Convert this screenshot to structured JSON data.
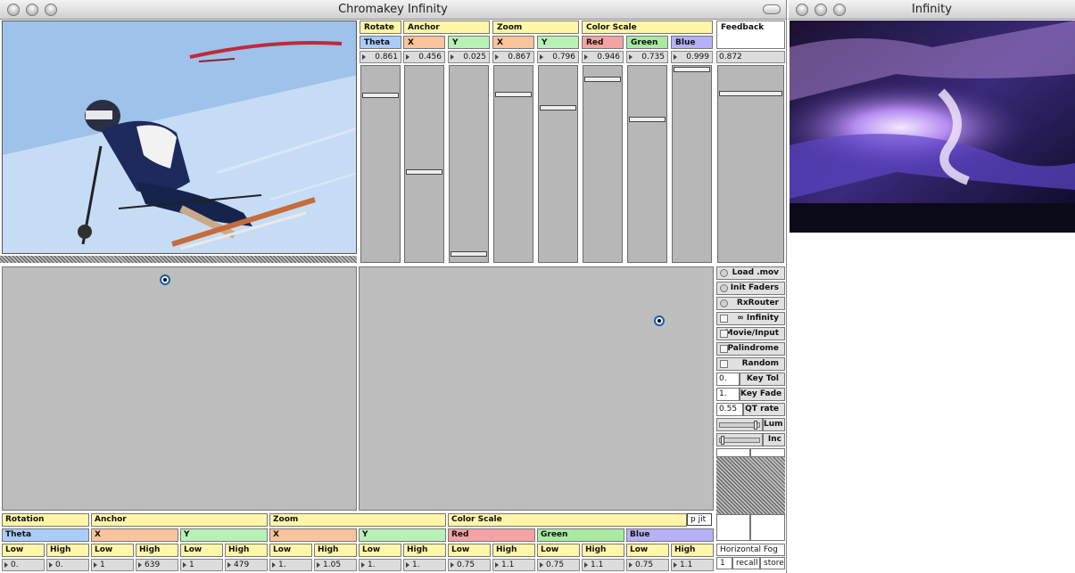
{
  "main_window": {
    "title": "Chromakey Infinity"
  },
  "output_window": {
    "title": "Infinity"
  },
  "top_controls": {
    "groups": [
      {
        "label": "Rotate"
      },
      {
        "label": "Anchor"
      },
      {
        "label": "Zoom"
      },
      {
        "label": "Color Scale"
      },
      {
        "label": "Feedback"
      }
    ],
    "channels": [
      {
        "label": "Theta",
        "value": "0.861",
        "level": 0.861
      },
      {
        "label": "X",
        "value": "0.456",
        "level": 0.456
      },
      {
        "label": "Y",
        "value": "0.025",
        "level": 0.025
      },
      {
        "label": "X",
        "value": "0.867",
        "level": 0.867
      },
      {
        "label": "Y",
        "value": "0.796",
        "level": 0.796
      },
      {
        "label": "Red",
        "value": "0.946",
        "level": 0.946
      },
      {
        "label": "Green",
        "value": "0.735",
        "level": 0.735
      },
      {
        "label": "Blue",
        "value": "0.999",
        "level": 0.999
      },
      {
        "label": "",
        "value": "0.872",
        "level": 0.872
      }
    ]
  },
  "side_controls": {
    "load_mov": "Load .mov",
    "init_faders": "Init Faders",
    "rx_router": "RxRouter",
    "infinity": "Infinity",
    "infinity_icon": "∞",
    "movie_input": "Movie/Input",
    "palindrome": "Palindrome",
    "random": "Random",
    "key_tol_value": "0.",
    "key_tol_label": "Key Tol",
    "key_fade_value": "1.",
    "key_fade_label": "Key Fade",
    "qt_rate_value": "0.55",
    "qt_rate_label": "QT rate",
    "lum_label": "Lum",
    "lum_level": 0.92,
    "inc_label": "Inc",
    "inc_level": 0.05,
    "preset_name": "Horizontal Fog",
    "preset_number": "1",
    "recall": "recall",
    "store": "store"
  },
  "bottom_controls": {
    "p_jit": "p jit",
    "groups": [
      {
        "label": "Rotation"
      },
      {
        "label": "Anchor"
      },
      {
        "label": "Zoom"
      },
      {
        "label": "Color Scale"
      }
    ],
    "channels": [
      {
        "label": "Theta",
        "low_label": "Low",
        "high_label": "High",
        "low": "0.",
        "high": "0."
      },
      {
        "label": "X",
        "low_label": "Low",
        "high_label": "High",
        "low": "1",
        "high": "639"
      },
      {
        "label": "Y",
        "low_label": "Low",
        "high_label": "High",
        "low": "1",
        "high": "479"
      },
      {
        "label": "X",
        "low_label": "Low",
        "high_label": "High",
        "low": "1.",
        "high": "1.05"
      },
      {
        "label": "Y",
        "low_label": "Low",
        "high_label": "High",
        "low": "1.",
        "high": "1."
      },
      {
        "label": "Red",
        "low_label": "Low",
        "high_label": "High",
        "low": "0.75",
        "high": "1.1"
      },
      {
        "label": "Green",
        "low_label": "Low",
        "high_label": "High",
        "low": "0.75",
        "high": "1.1"
      },
      {
        "label": "Blue",
        "low_label": "Low",
        "high_label": "High",
        "low": "0.75",
        "high": "1.1"
      }
    ]
  }
}
